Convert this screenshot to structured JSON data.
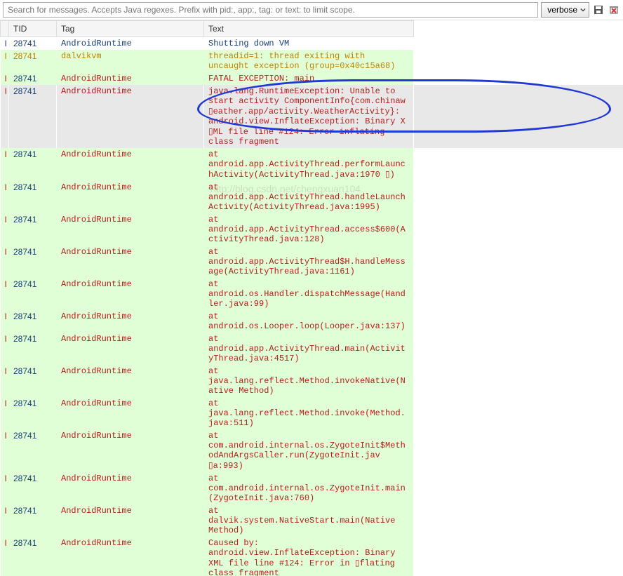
{
  "toolbar": {
    "search_placeholder": "Search for messages. Accepts Java regexes. Prefix with pid:, app:, tag: or text: to limit scope.",
    "dropdown_value": "verbose"
  },
  "columns": {
    "level": "",
    "tid": "TID",
    "tag": "Tag",
    "text": "Text"
  },
  "rows": [
    {
      "cls": "info",
      "l": "I",
      "tid": "28741",
      "tag": "AndroidRuntime",
      "text": "Shutting down VM"
    },
    {
      "cls": "warn",
      "l": "I",
      "tid": "28741",
      "tag": "dalvikvm",
      "text": "threadid=1: thread exiting with uncaught exception (group=0x40c15a68)"
    },
    {
      "cls": "err",
      "l": "I",
      "tid": "28741",
      "tag": "AndroidRuntime",
      "text": "FATAL EXCEPTION: main"
    },
    {
      "cls": "err selected",
      "l": "I",
      "tid": "28741",
      "tag": "AndroidRuntime",
      "text": "java.lang.RuntimeException: Unable to start activity ComponentInfo{com.chinaw ▯eather.app/activity.WeatherActivity}: android.view.InflateException: Binary X ▯ML file line #124: Error inflating class fragment"
    },
    {
      "cls": "err",
      "l": "I",
      "tid": "28741",
      "tag": "AndroidRuntime",
      "text": "at android.app.ActivityThread.performLaunchActivity(ActivityThread.java:1970 ▯)"
    },
    {
      "cls": "err",
      "l": "I",
      "tid": "28741",
      "tag": "AndroidRuntime",
      "text": "at android.app.ActivityThread.handleLaunchActivity(ActivityThread.java:1995)"
    },
    {
      "cls": "err",
      "l": "I",
      "tid": "28741",
      "tag": "AndroidRuntime",
      "text": "at android.app.ActivityThread.access$600(ActivityThread.java:128)"
    },
    {
      "cls": "err",
      "l": "I",
      "tid": "28741",
      "tag": "AndroidRuntime",
      "text": "at android.app.ActivityThread$H.handleMessage(ActivityThread.java:1161)"
    },
    {
      "cls": "err",
      "l": "I",
      "tid": "28741",
      "tag": "AndroidRuntime",
      "text": "at android.os.Handler.dispatchMessage(Handler.java:99)"
    },
    {
      "cls": "err",
      "l": "I",
      "tid": "28741",
      "tag": "AndroidRuntime",
      "text": "at android.os.Looper.loop(Looper.java:137)"
    },
    {
      "cls": "err",
      "l": "I",
      "tid": "28741",
      "tag": "AndroidRuntime",
      "text": "at android.app.ActivityThread.main(ActivityThread.java:4517)"
    },
    {
      "cls": "err",
      "l": "I",
      "tid": "28741",
      "tag": "AndroidRuntime",
      "text": "at java.lang.reflect.Method.invokeNative(Native Method)"
    },
    {
      "cls": "err",
      "l": "I",
      "tid": "28741",
      "tag": "AndroidRuntime",
      "text": "at java.lang.reflect.Method.invoke(Method.java:511)"
    },
    {
      "cls": "err",
      "l": "I",
      "tid": "28741",
      "tag": "AndroidRuntime",
      "text": "at com.android.internal.os.ZygoteInit$MethodAndArgsCaller.run(ZygoteInit.jav ▯a:993)"
    },
    {
      "cls": "err",
      "l": "I",
      "tid": "28741",
      "tag": "AndroidRuntime",
      "text": "at com.android.internal.os.ZygoteInit.main(ZygoteInit.java:760)"
    },
    {
      "cls": "err",
      "l": "I",
      "tid": "28741",
      "tag": "AndroidRuntime",
      "text": "at dalvik.system.NativeStart.main(Native Method)"
    },
    {
      "cls": "err",
      "l": "I",
      "tid": "28741",
      "tag": "AndroidRuntime",
      "text": "Caused by: android.view.InflateException: Binary XML file line #124: Error in ▯flating class fragment"
    }
  ],
  "watermark": "http://blog.csdn.net/chengxuan104",
  "annotation": {
    "circled_row_index": 3,
    "circle_color": "#2238d4"
  }
}
